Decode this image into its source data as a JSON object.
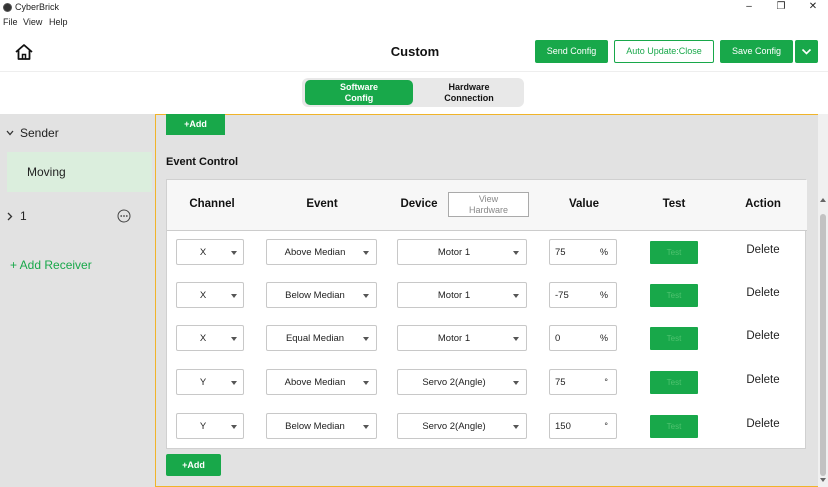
{
  "window": {
    "title": "CyberBrick",
    "minimize": "–",
    "maximize": "❐",
    "close": "✕"
  },
  "menu": [
    "File",
    "View",
    "Help"
  ],
  "header": {
    "title": "Custom",
    "send_config": "Send Config",
    "auto_update": "Auto Update:Close",
    "save_config": "Save Config"
  },
  "tabs": {
    "software_line1": "Software",
    "software_line2": "Config",
    "hardware_line1": "Hardware",
    "hardware_line2": "Connection"
  },
  "sidebar": {
    "sender_label": "Sender",
    "moving_label": "Moving",
    "receiver_label": "1",
    "add_receiver": "+ Add Receiver"
  },
  "main": {
    "add_top": "+Add",
    "section_title": "Event Control",
    "add_bottom": "+Add",
    "headers": {
      "channel": "Channel",
      "event": "Event",
      "device": "Device",
      "view_hw_line1": "View",
      "view_hw_line2": "Hardware",
      "value": "Value",
      "test": "Test",
      "action": "Action"
    },
    "rows": [
      {
        "channel": "X",
        "event": "Above Median",
        "device": "Motor 1",
        "value": "75",
        "unit": "%",
        "test": "Test",
        "action": "Delete"
      },
      {
        "channel": "X",
        "event": "Below Median",
        "device": "Motor 1",
        "value": "-75",
        "unit": "%",
        "test": "Test",
        "action": "Delete"
      },
      {
        "channel": "X",
        "event": "Equal Median",
        "device": "Motor 1",
        "value": "0",
        "unit": "%",
        "test": "Test",
        "action": "Delete"
      },
      {
        "channel": "Y",
        "event": "Above Median",
        "device": "Servo 2(Angle)",
        "value": "75",
        "unit": "°",
        "test": "Test",
        "action": "Delete"
      },
      {
        "channel": "Y",
        "event": "Below Median",
        "device": "Servo 2(Angle)",
        "value": "150",
        "unit": "°",
        "test": "Test",
        "action": "Delete"
      }
    ]
  },
  "colors": {
    "accent": "#18a84a",
    "panel": "#e2e2e2",
    "selected": "#dbeedd",
    "focus_border": "#f0b429"
  }
}
